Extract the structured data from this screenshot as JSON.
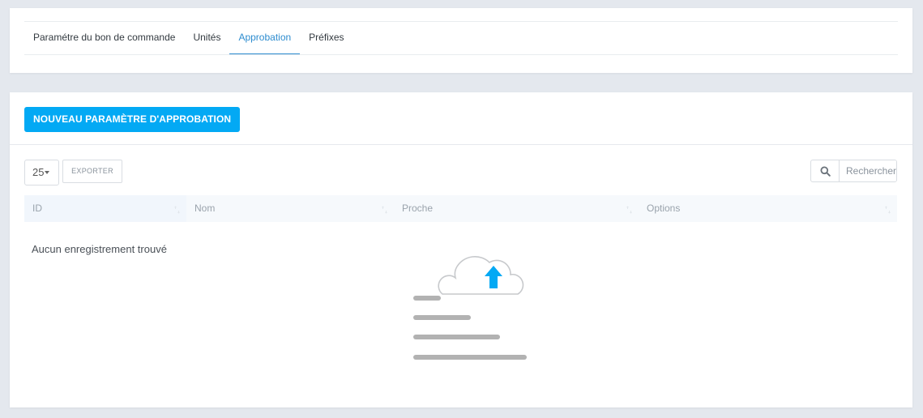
{
  "tabs": [
    {
      "label": "Paramétre du bon de commande",
      "active": false
    },
    {
      "label": "Unités",
      "active": false
    },
    {
      "label": "Approbation",
      "active": true
    },
    {
      "label": "Préfixes",
      "active": false
    }
  ],
  "toolbar": {
    "new_button_label": "NOUVEAU PARAMÈTRE D'APPROBATION",
    "page_length": "25",
    "export_label": "EXPORTER",
    "search_placeholder": "Rechercher"
  },
  "table": {
    "columns": [
      "ID",
      "Nom",
      "Proche",
      "Options"
    ],
    "empty_message": "Aucun enregistrement trouvé"
  },
  "colors": {
    "accent": "#03a9f4",
    "active_tab": "#2d8ccf",
    "background": "#e4e8ee"
  },
  "icons": {
    "search": "search-icon",
    "sort": "sort-icon",
    "empty_state": "cloud-upload-icon"
  }
}
